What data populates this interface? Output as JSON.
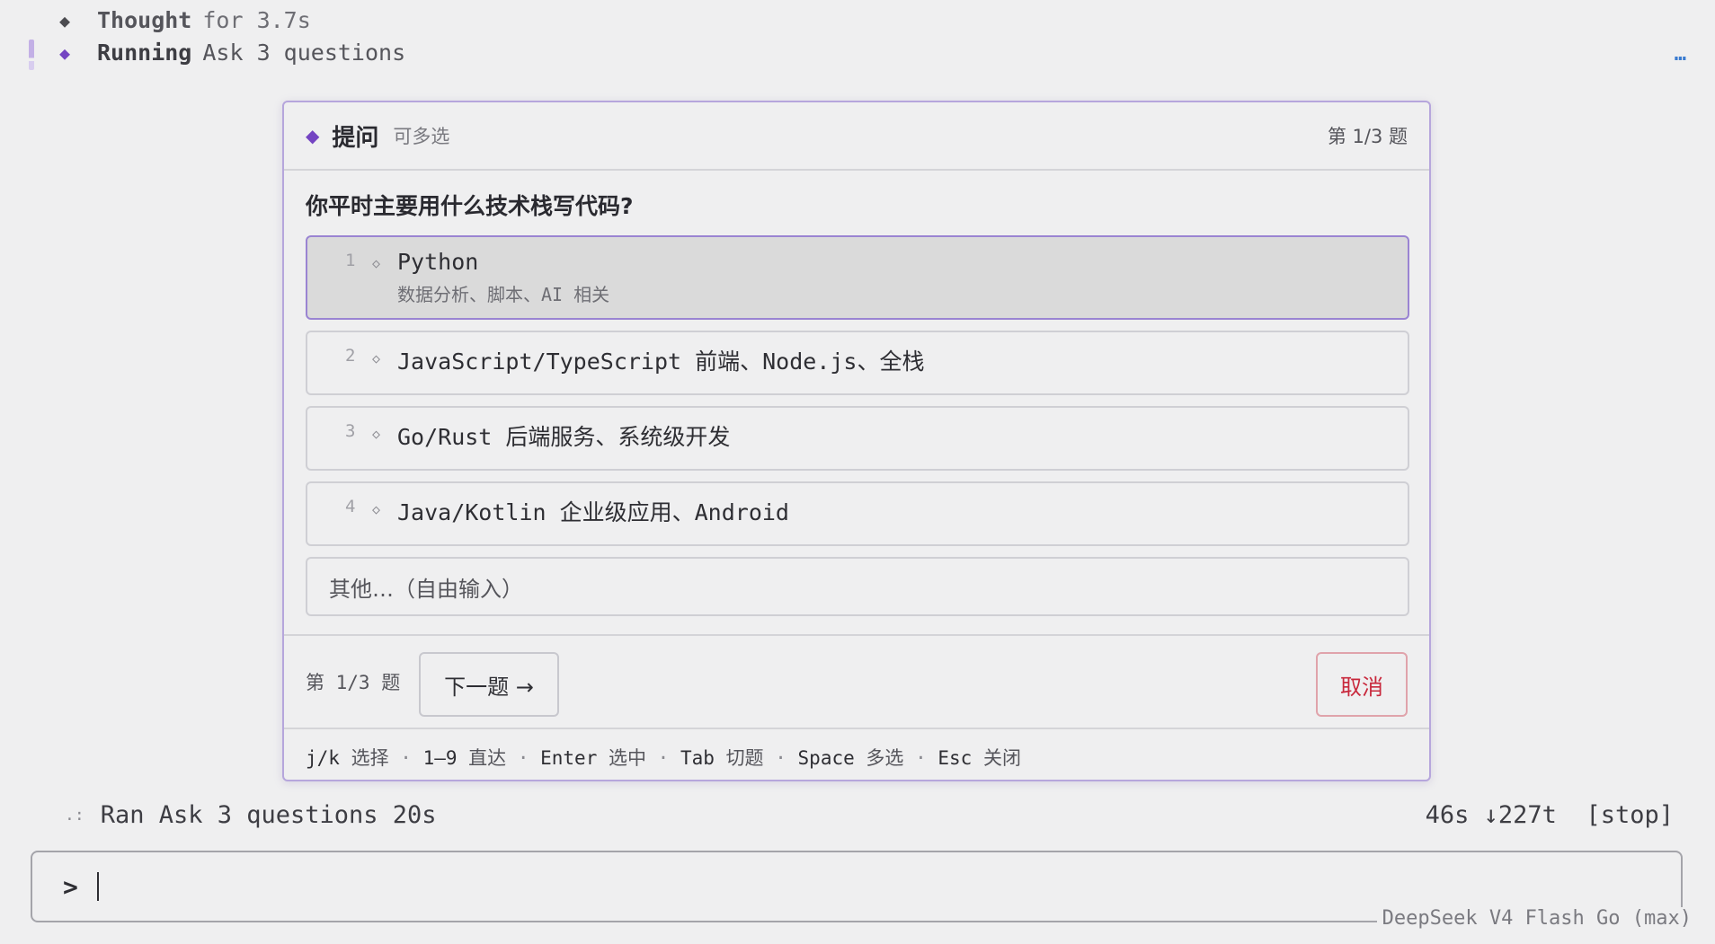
{
  "log": {
    "thought": {
      "label": "Thought",
      "detail": "for 3.7s"
    },
    "running": {
      "label": "Running",
      "detail": "Ask 3 questions"
    },
    "more": "…"
  },
  "card": {
    "header": {
      "title": "提问",
      "subtitle": "可多选",
      "counter": "第 1/3 题"
    },
    "question": "你平时主要用什么技术栈写代码?",
    "options": [
      {
        "num": "1",
        "text": "Python",
        "desc": "数据分析、脚本、AI 相关",
        "selected": true
      },
      {
        "num": "2",
        "text": "JavaScript/TypeScript 前端、Node.js、全栈"
      },
      {
        "num": "3",
        "text": "Go/Rust 后端服务、系统级开发"
      },
      {
        "num": "4",
        "text": "Java/Kotlin 企业级应用、Android"
      }
    ],
    "other_placeholder": "其他…（自由输入）",
    "footer": {
      "counter": "第 1/3 题",
      "next": "下一题 →",
      "cancel": "取消"
    },
    "shortcuts": [
      {
        "key": "j/k",
        "desc": "选择"
      },
      {
        "key": "1–9",
        "desc": "直达"
      },
      {
        "key": "Enter",
        "desc": "选中"
      },
      {
        "key": "Tab",
        "desc": "切题"
      },
      {
        "key": "Space",
        "desc": "多选"
      },
      {
        "key": "Esc",
        "desc": "关闭"
      }
    ]
  },
  "status": {
    "spinner": ".:",
    "text": "Ran Ask 3 questions 20s",
    "elapsed": "46s",
    "tokens": "↓227t",
    "stop": "[stop]"
  },
  "prompt": {
    "chevron": ">",
    "model": "DeepSeek V4 Flash Go (max)"
  }
}
